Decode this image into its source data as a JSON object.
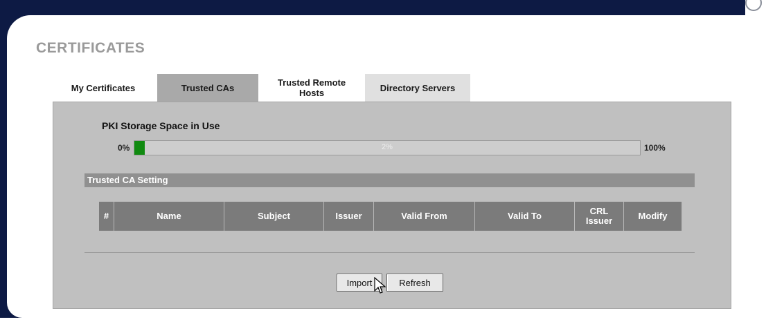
{
  "page": {
    "title": "CERTIFICATES"
  },
  "tabs": [
    {
      "label": "My Certificates",
      "active": false
    },
    {
      "label": "Trusted CAs",
      "active": true
    },
    {
      "label": "Trusted Remote Hosts",
      "active": false
    },
    {
      "label": "Directory Servers",
      "active": false
    }
  ],
  "pki": {
    "title": "PKI Storage Space in Use",
    "min_label": "0%",
    "max_label": "100%",
    "usage_label": "2%",
    "usage_fraction": 0.02,
    "fill_color": "#108a10"
  },
  "section": {
    "title": "Trusted CA Setting"
  },
  "table": {
    "columns": [
      "#",
      "Name",
      "Subject",
      "Issuer",
      "Valid From",
      "Valid To",
      "CRL Issuer",
      "Modify"
    ],
    "rows": []
  },
  "buttons": {
    "import": "Import",
    "refresh": "Refresh"
  },
  "icons": {
    "cursor": "arrow-cursor-icon"
  }
}
